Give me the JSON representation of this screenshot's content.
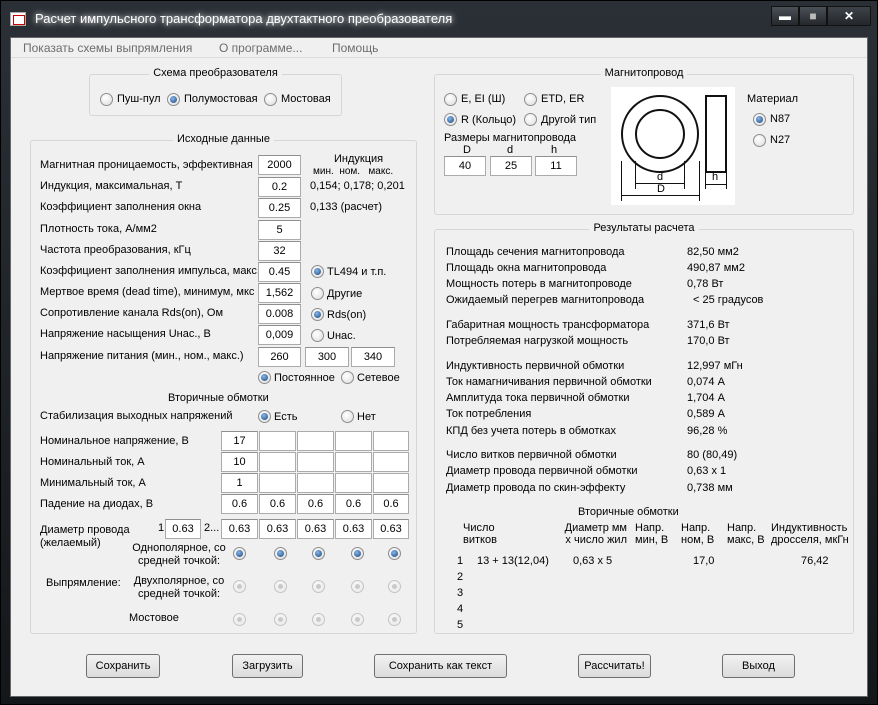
{
  "window": {
    "title": "Расчет импульсного трансформатора двухтактного преобразователя",
    "min": "▬",
    "max": "■",
    "close": "✕"
  },
  "menu": [
    "Показать схемы выпрямления",
    "О программе...",
    "Помощь"
  ],
  "scheme": {
    "title": "Схема преобразователя",
    "options": [
      "Пуш-пул",
      "Полумостовая",
      "Мостовая"
    ],
    "selected": 1
  },
  "inputs": {
    "title": "Исходные данные",
    "rows": [
      {
        "label": "Магнитная проницаемость, эффективная",
        "value": "2000"
      },
      {
        "label": "Индукция, максимальная, Т",
        "value": "0.2"
      },
      {
        "label": "Коэффициент заполнения окна",
        "value": "0.25"
      },
      {
        "label": "Плотность тока, А/мм2",
        "value": "5"
      },
      {
        "label": "Частота преобразования, кГц",
        "value": "32"
      },
      {
        "label": "Коэффициент заполнения импульса, макс.",
        "value": "0.45"
      },
      {
        "label": "Мертвое время (dead time), минимум, мкс",
        "value": "1,562"
      },
      {
        "label": "Сопротивление канала Rds(on), Ом",
        "value": "0.008"
      },
      {
        "label": "Напряжение насыщения Uнас., В",
        "value": "0,009"
      },
      {
        "label": "Напряжение питания (мин., ном., макс.)",
        "value": "260",
        "v2": "300",
        "v3": "340"
      }
    ],
    "induction": {
      "title": "Индукция",
      "cols": "мин.  ном.   макс.",
      "values": "0,154; 0,178; 0,201"
    },
    "fill_calc": "0,133 (расчет)",
    "ctrl": [
      "TL494 и т.п.",
      "Другие"
    ],
    "rds": [
      "Rds(on)",
      "Uнас."
    ],
    "supply": [
      "Постоянное",
      "Сетевое"
    ]
  },
  "secondary": {
    "title": "Вторичные обмотки",
    "stab_label": "Стабилизация выходных напряжений",
    "stab": [
      "Есть",
      "Нет"
    ],
    "nom_v_label": "Номинальное напряжение, В",
    "nom_v": [
      "17",
      "",
      "",
      "",
      ""
    ],
    "nom_i_label": "Номинальный ток, А",
    "nom_i": [
      "10",
      "",
      "",
      "",
      ""
    ],
    "min_i_label": "Минимальный ток, А",
    "min_i": [
      "1",
      "",
      "",
      "",
      ""
    ],
    "diode_label": "Падение на диодах, В",
    "diode": [
      "0.6",
      "0.6",
      "0.6",
      "0.6",
      "0.6"
    ],
    "wire_label": "Диаметр провода",
    "wire_label2": "(желаемый)",
    "wire_n1": "1",
    "wire_n2": "2...",
    "wire": [
      "0.63",
      "0.63",
      "0.63",
      "0.63",
      "0.63",
      "0.63"
    ],
    "rect_label": "Выпрямление:",
    "rect": [
      "Однополярное, со средней точкой:",
      "Двухполярное, со средней точкой:",
      "Мостовое"
    ]
  },
  "core": {
    "title": "Магнитопровод",
    "types": [
      "E, EI (Ш)",
      "ETD, ER",
      "R (Кольцо)",
      "Другой тип"
    ],
    "selected": 2,
    "dims_title": "Размеры магнитопровода",
    "dim_names": [
      "D",
      "d",
      "h"
    ],
    "dims": [
      "40",
      "25",
      "11"
    ],
    "material_title": "Материал",
    "materials": [
      "N87",
      "N27"
    ],
    "mat_selected": 0,
    "drawing": {
      "d": "d",
      "D": "D",
      "h": "h"
    }
  },
  "results": {
    "title": "Результаты расчета",
    "rows": [
      {
        "label": "Площадь сечения магнитопровода",
        "value": "82,50 мм2"
      },
      {
        "label": "Площадь окна магнитопровода",
        "value": "490,87 мм2"
      },
      {
        "label": "Мощность потерь в магнитопроводе",
        "value": "0,78 Вт"
      },
      {
        "label": "Ожидаемый перегрев магнитопровода",
        "value": "< 25 градусов"
      },
      {
        "label": "Габаритная мощность трансформатора",
        "value": "371,6 Вт"
      },
      {
        "label": "Потребляемая нагрузкой мощность",
        "value": "170,0 Вт"
      },
      {
        "label": "Индуктивность первичной обмотки",
        "value": "12,997 мГн"
      },
      {
        "label": "Ток намагничивания первичной обмотки",
        "value": "0,074 А"
      },
      {
        "label": "Амплитуда тока первичной обмотки",
        "value": "1,704 А"
      },
      {
        "label": "Ток потребления",
        "value": "0,589 А"
      },
      {
        "label": "КПД без учета потерь в обмотках",
        "value": "96,28 %"
      },
      {
        "label": "Число витков первичной обмотки",
        "value": "80 (80,49)"
      },
      {
        "label": "Диаметр провода первичной обмотки",
        "value": "0,63 x 1"
      },
      {
        "label": "Диаметр провода по скин-эффекту",
        "value": "0,738 мм"
      }
    ],
    "sec_title": "Вторичные обмотки",
    "sec_headers": [
      "Число витков",
      "Диаметр мм x число жил",
      "Напр. мин, В",
      "Напр. ном, В",
      "Напр. макс, В",
      "Индуктивность дросселя, мкГн"
    ],
    "sec_rows": [
      {
        "n": "1",
        "turns": "13 + 13(12,04)",
        "wire": "0,63 x 5",
        "vmin": "",
        "vnom": "17,0",
        "vmax": "",
        "ind": "76,42"
      },
      {
        "n": "2",
        "turns": "",
        "wire": "",
        "vmin": "",
        "vnom": "",
        "vmax": "",
        "ind": ""
      },
      {
        "n": "3",
        "turns": "",
        "wire": "",
        "vmin": "",
        "vnom": "",
        "vmax": "",
        "ind": ""
      },
      {
        "n": "4",
        "turns": "",
        "wire": "",
        "vmin": "",
        "vnom": "",
        "vmax": "",
        "ind": ""
      },
      {
        "n": "5",
        "turns": "",
        "wire": "",
        "vmin": "",
        "vnom": "",
        "vmax": "",
        "ind": ""
      }
    ]
  },
  "buttons": [
    "Сохранить",
    "Загрузить",
    "Сохранить как текст",
    "Рассчитать!",
    "Выход"
  ]
}
